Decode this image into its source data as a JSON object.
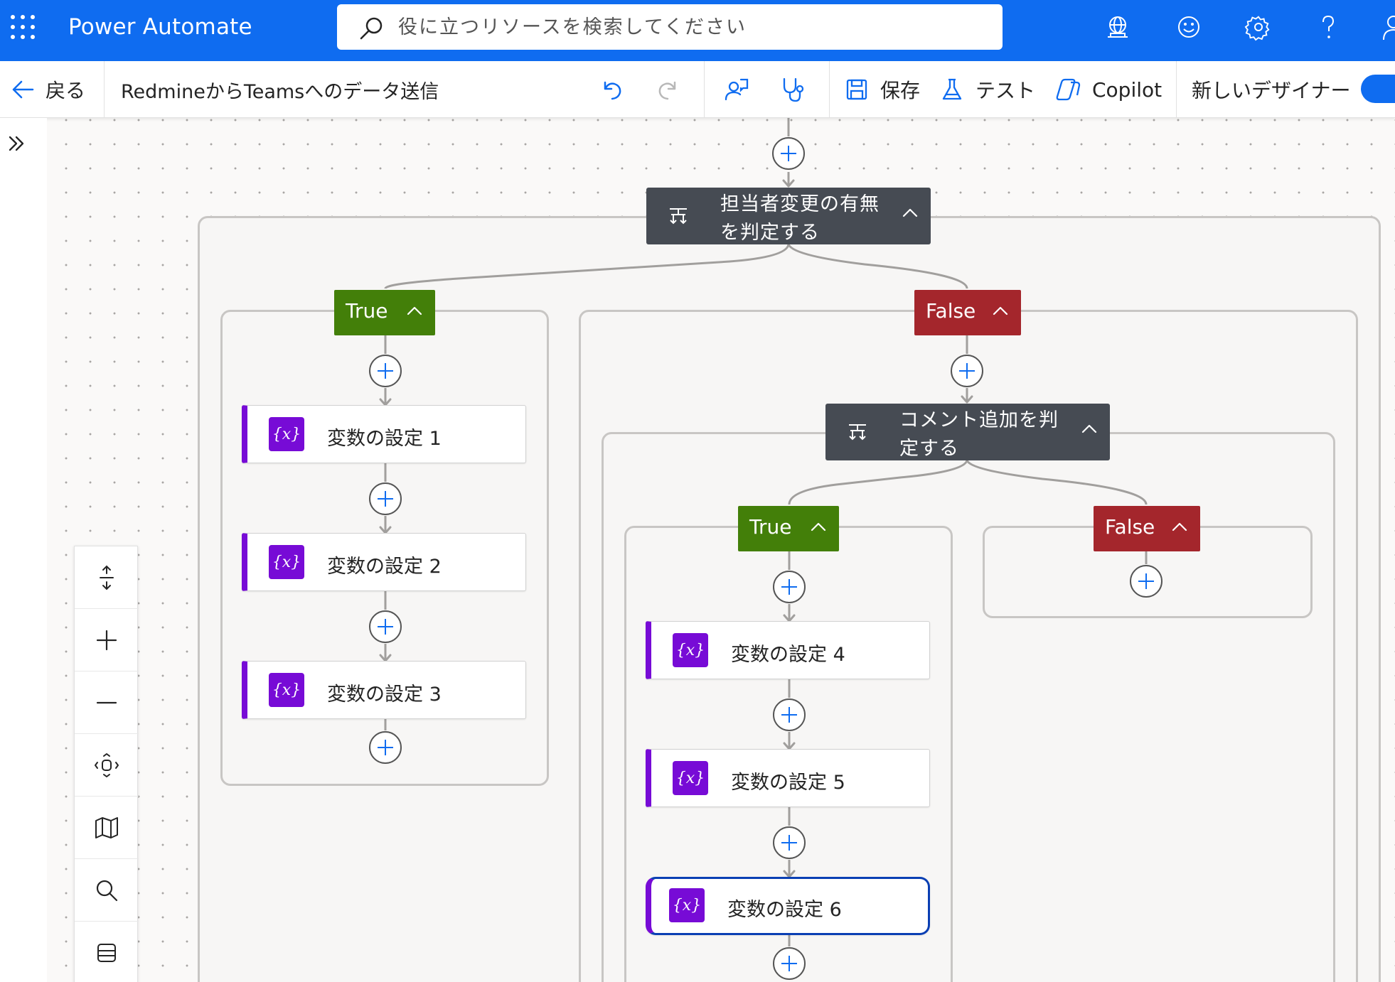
{
  "header": {
    "app_title": "Power Automate",
    "search_placeholder": "役に立つリソースを検索してください",
    "icons": [
      "waffle-icon",
      "environment-globe-icon",
      "feedback-smiley-icon",
      "settings-gear-icon",
      "help-question-icon",
      "account-icon"
    ]
  },
  "commandbar": {
    "back_label": "戻る",
    "flow_name": "RedmineからTeamsへのデータ送信",
    "save_label": "保存",
    "test_label": "テスト",
    "copilot_label": "Copilot",
    "new_designer_label": "新しいデザイナー",
    "new_designer_on": true
  },
  "flow": {
    "condition1": {
      "title": "担当者変更の有無を判定する",
      "true_label": "True",
      "false_label": "False",
      "true_actions": [
        "変数の設定 1",
        "変数の設定 2",
        "変数の設定 3"
      ]
    },
    "condition2": {
      "title": "コメント追加を判定する",
      "true_label": "True",
      "false_label": "False",
      "true_actions": [
        "変数の設定 4",
        "変数の設定 5",
        "変数の設定 6"
      ],
      "selected_action": "変数の設定 6"
    },
    "action_icon_text": "{x}"
  },
  "zoom_controls": [
    "fit-height-icon",
    "zoom-in-icon",
    "zoom-out-icon",
    "fit-view-icon",
    "minimap-icon",
    "search-icon",
    "collapse-all-icon"
  ],
  "colors": {
    "brand_blue": "#0f6cf0",
    "condition_header": "#464b53",
    "true_green": "#437f09",
    "false_red": "#a4262c",
    "variable_purple": "#770bd6"
  }
}
